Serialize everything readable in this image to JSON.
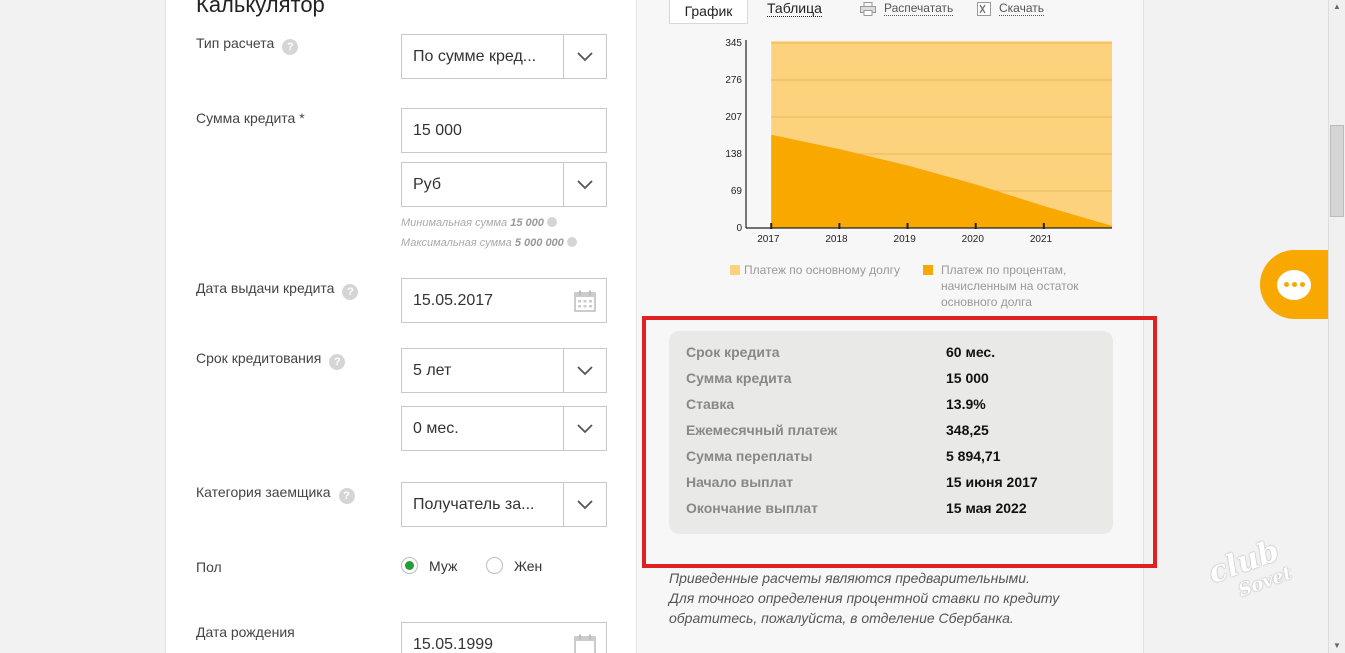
{
  "form": {
    "heading": "Калькулятор",
    "calc_type": {
      "label": "Тип расчета",
      "value": "По сумме кред..."
    },
    "loan_amount": {
      "label": "Сумма кредита *",
      "value": "15 000"
    },
    "currency": {
      "value": "Руб"
    },
    "min_hint": {
      "label": "Минимальная сумма",
      "value": "15 000"
    },
    "max_hint": {
      "label": "Максимальная сумма",
      "value": "5 000 000"
    },
    "issue_date": {
      "label": "Дата выдачи кредита",
      "value": "15.05.2017"
    },
    "term": {
      "label": "Срок кредитования",
      "years": "5 лет",
      "months": "0 мес."
    },
    "category": {
      "label": "Категория заемщика",
      "value": "Получатель за..."
    },
    "gender": {
      "label": "Пол",
      "male": "Муж",
      "female": "Жен",
      "selected": "male"
    },
    "birth_date": {
      "label": "Дата рождения",
      "value": "15.05.1999"
    },
    "help_glyph": "?"
  },
  "toolbar": {
    "tab_chart": "График",
    "tab_table": "Таблица",
    "print": "Распечатать",
    "download": "Скачать"
  },
  "chart_data": {
    "type": "area",
    "x": [
      "2017",
      "2018",
      "2019",
      "2020",
      "2021"
    ],
    "y_ticks": [
      "0",
      "69",
      "138",
      "207",
      "276",
      "345"
    ],
    "ylim": [
      0,
      345
    ],
    "series": [
      {
        "name": "Платеж по основному долгу",
        "color": "#fdd27d",
        "points": [
          [
            2017.37,
            348.25
          ],
          [
            2022.37,
            348.25
          ]
        ]
      },
      {
        "name": "Платеж по процентам, начисленным на остаток основного долга",
        "color": "#f9a800",
        "points": [
          [
            2017.37,
            173.8
          ],
          [
            2018.37,
            147.2
          ],
          [
            2019.37,
            116.5
          ],
          [
            2020.37,
            81.3
          ],
          [
            2021.37,
            41.0
          ],
          [
            2022.37,
            4.0
          ]
        ]
      }
    ],
    "grid": true
  },
  "summary": [
    {
      "key": "Срок кредита",
      "value": "60 мес."
    },
    {
      "key": "Сумма кредита",
      "value": "15 000"
    },
    {
      "key": "Ставка",
      "value": "13.9%"
    },
    {
      "key": "Ежемесячный платеж",
      "value": "348,25"
    },
    {
      "key": "Сумма переплаты",
      "value": "5 894,71"
    },
    {
      "key": "Начало выплат",
      "value": "15 июня 2017"
    },
    {
      "key": "Окончание выплат",
      "value": "15 мая 2022"
    }
  ],
  "disclaimer": [
    "Приведенные расчеты являются предварительными.",
    "Для точного определения процентной ставки по кредиту",
    "обратитесь, пожалуйста, в отделение Сбербанка."
  ],
  "watermark": {
    "line1": "club",
    "line2": "Sovet"
  },
  "colors": {
    "accent": "#f8a800",
    "highlight_frame": "#e02023",
    "radio_selected": "#21a038"
  }
}
